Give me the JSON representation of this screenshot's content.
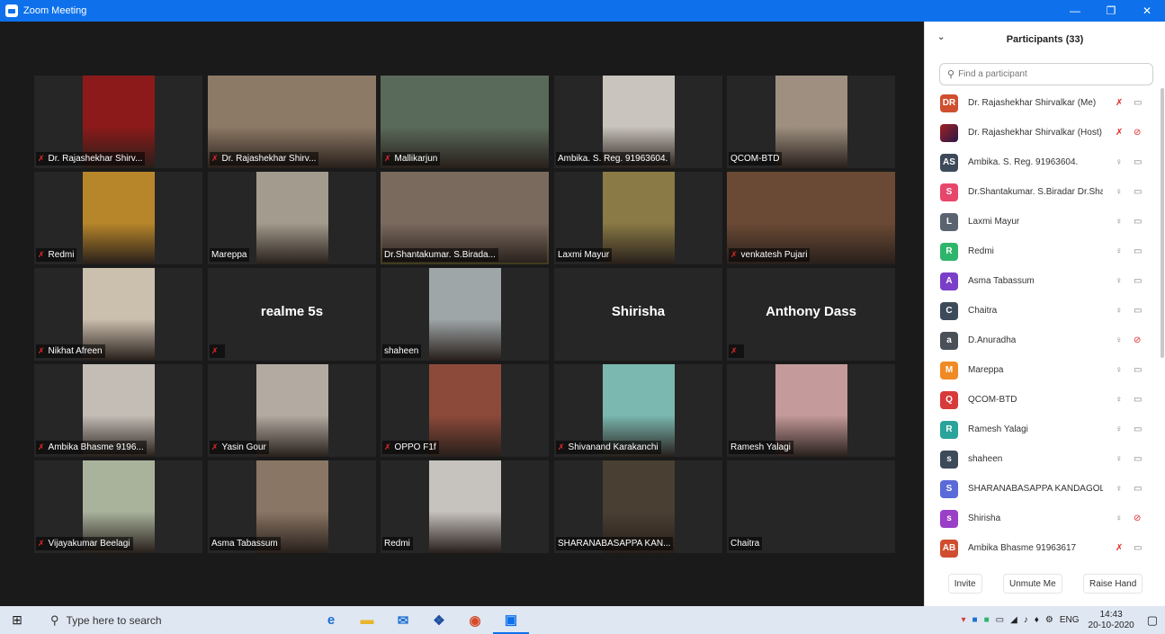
{
  "window": {
    "title": "Zoom Meeting",
    "minimize": "—",
    "maximize": "❐",
    "close": "✕"
  },
  "gallery": [
    [
      {
        "name": "Dr. Rajashekhar Shirv...",
        "muted": true,
        "video": true,
        "bg": "#8c1a1a"
      },
      {
        "name": "Dr. Rajashekhar Shirv...",
        "muted": true,
        "video": true,
        "bg": "#8d7a66"
      },
      {
        "name": "Mallikarjun",
        "muted": true,
        "video": true,
        "bg": "#5a6a5a"
      },
      {
        "name": "Ambika. S. Reg. 91963604.",
        "muted": false,
        "video": true,
        "bg": "#c9c4bd"
      },
      {
        "name": "QCOM-BTD",
        "muted": false,
        "video": true,
        "bg": "#9e8f80"
      }
    ],
    [
      {
        "name": "Redmi",
        "muted": true,
        "video": true,
        "bg": "#b8862a"
      },
      {
        "name": "Mareppa",
        "muted": false,
        "video": true,
        "bg": "#a39b8d"
      },
      {
        "name": "Dr.Shantakumar. S.Birada...",
        "muted": false,
        "video": true,
        "bg": "#7a6a5e",
        "active": true
      },
      {
        "name": "Laxmi Mayur",
        "muted": false,
        "video": true,
        "bg": "#8a7a45"
      },
      {
        "name": "venkatesh Pujari",
        "muted": true,
        "video": true,
        "bg": "#6b4a35"
      }
    ],
    [
      {
        "name": "Nikhat Afreen",
        "muted": true,
        "video": true,
        "bg": "#cbbfae"
      },
      {
        "name": "",
        "muted": true,
        "video": false,
        "caption": "realme 5s"
      },
      {
        "name": "shaheen",
        "muted": false,
        "video": true,
        "bg": "#9fa6a8"
      },
      {
        "name": "",
        "muted": false,
        "video": false,
        "caption": "Shirisha"
      },
      {
        "name": "",
        "muted": true,
        "video": false,
        "caption": "Anthony Dass"
      }
    ],
    [
      {
        "name": "Ambika Bhasme 9196...",
        "muted": true,
        "video": true,
        "bg": "#c4bdb6"
      },
      {
        "name": "Yasin Gour",
        "muted": true,
        "video": true,
        "bg": "#b3aaa1"
      },
      {
        "name": "OPPO F1f",
        "muted": true,
        "video": true,
        "bg": "#8c4a3a"
      },
      {
        "name": "Shivanand Karakanchi",
        "muted": true,
        "video": true,
        "bg": "#7ab8b0"
      },
      {
        "name": "Ramesh Yalagi",
        "muted": false,
        "video": true,
        "bg": "#c49a9a"
      }
    ],
    [
      {
        "name": "Vijayakumar Beelagi",
        "muted": true,
        "video": true,
        "bg": "#a9b39c"
      },
      {
        "name": "Asma Tabassum",
        "muted": false,
        "video": true,
        "bg": "#8a7665"
      },
      {
        "name": "Redmi",
        "muted": false,
        "video": true,
        "bg": "#c6c2be"
      },
      {
        "name": "SHARANABASAPPA KAN...",
        "muted": false,
        "video": true,
        "bg": "#4a3f33"
      },
      {
        "name": "Chaitra",
        "muted": false,
        "video": false,
        "caption": ""
      }
    ]
  ],
  "participants": {
    "title": "Participants (33)",
    "search_placeholder": "Find a participant",
    "list": [
      {
        "initials": "DR",
        "color": "#d04e2f",
        "name": "Dr. Rajashekhar  Shirvalkar (Me)",
        "mic_off": true,
        "cam_off": false
      },
      {
        "initials": "",
        "color": "#7a1a1a",
        "name": "Dr. Rajashekhar Shirvalkar (Host)",
        "mic_off": true,
        "cam_off": true,
        "image": true
      },
      {
        "initials": "AS",
        "color": "#3c4a5a",
        "name": "Ambika. S. Reg. 91963604.",
        "mic_off": false,
        "cam_off": false
      },
      {
        "initials": "S",
        "color": "#e8466b",
        "name": "Dr.Shantakumar. S.Biradar Dr.Sha...",
        "mic_off": false,
        "cam_off": false
      },
      {
        "initials": "L",
        "color": "#5a6470",
        "name": "Laxmi Mayur",
        "mic_off": false,
        "cam_off": false
      },
      {
        "initials": "R",
        "color": "#2fb56b",
        "name": "Redmi",
        "mic_off": false,
        "cam_off": false
      },
      {
        "initials": "A",
        "color": "#7a3fc8",
        "name": "Asma Tabassum",
        "mic_off": false,
        "cam_off": false
      },
      {
        "initials": "C",
        "color": "#3c4a5a",
        "name": "Chaitra",
        "mic_off": false,
        "cam_off": false
      },
      {
        "initials": "a",
        "color": "#4a5058",
        "name": "D.Anuradha",
        "mic_off": false,
        "cam_off": true
      },
      {
        "initials": "M",
        "color": "#f08a24",
        "name": "Mareppa",
        "mic_off": false,
        "cam_off": false
      },
      {
        "initials": "Q",
        "color": "#d83a3a",
        "name": "QCOM-BTD",
        "mic_off": false,
        "cam_off": false
      },
      {
        "initials": "R",
        "color": "#2aa39a",
        "name": "Ramesh Yalagi",
        "mic_off": false,
        "cam_off": false
      },
      {
        "initials": "s",
        "color": "#3c4a5a",
        "name": "shaheen",
        "mic_off": false,
        "cam_off": false
      },
      {
        "initials": "S",
        "color": "#5a6ad8",
        "name": "SHARANABASAPPA KANDAGOL",
        "mic_off": false,
        "cam_off": false
      },
      {
        "initials": "s",
        "color": "#9a3fc8",
        "name": "Shirisha",
        "mic_off": false,
        "cam_off": true
      },
      {
        "initials": "AB",
        "color": "#d04e2f",
        "name": "Ambika Bhasme 91963617",
        "mic_off": true,
        "cam_off": false
      }
    ],
    "footer": {
      "invite": "Invite",
      "unmute": "Unmute Me",
      "raise_hand": "Raise Hand"
    }
  },
  "taskbar": {
    "search_placeholder": "Type here to search",
    "lang": "ENG",
    "time": "14:43",
    "date": "20-10-2020"
  }
}
